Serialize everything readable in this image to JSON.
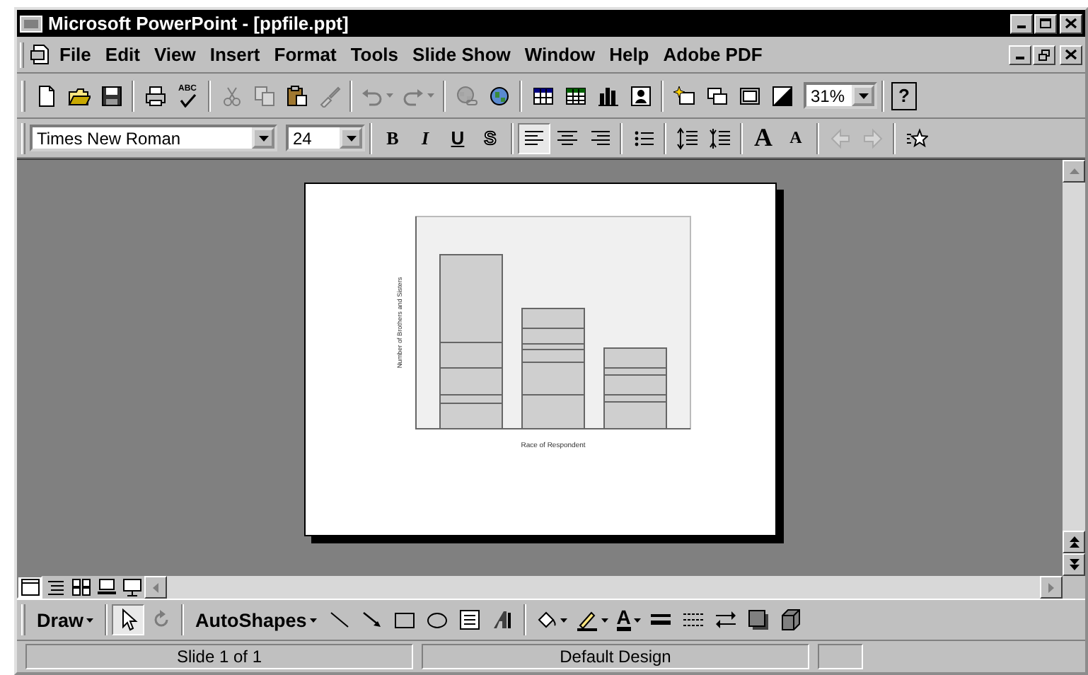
{
  "window": {
    "title": "Microsoft PowerPoint - [ppfile.ppt]"
  },
  "menu_bar": {
    "items": [
      "File",
      "Edit",
      "View",
      "Insert",
      "Format",
      "Tools",
      "Slide Show",
      "Window",
      "Help",
      "Adobe PDF"
    ]
  },
  "standard_toolbar": {
    "buttons": [
      {
        "disabled": false
      },
      {
        "disabled": false
      },
      {
        "disabled": false
      },
      {
        "disabled": false
      },
      {
        "disabled": false
      },
      {
        "disabled": true
      },
      {
        "disabled": true
      },
      {
        "disabled": false
      },
      {
        "disabled": true
      },
      {
        "disabled": true
      },
      {
        "disabled": true
      },
      {
        "disabled": true
      },
      {
        "disabled": false
      },
      {
        "disabled": false
      },
      {
        "disabled": false
      },
      {
        "disabled": false
      },
      {
        "disabled": false
      },
      {
        "disabled": false
      },
      {
        "disabled": false
      },
      {
        "disabled": false
      },
      {
        "disabled": false
      }
    ],
    "spelling_label": "ABC",
    "zoom": "31%",
    "help_label": "?"
  },
  "formatting_toolbar": {
    "font": "Times New Roman",
    "size": "24",
    "styles": [
      {
        "label": "B"
      },
      {
        "label": "I"
      },
      {
        "label": "U"
      },
      {
        "label": "S"
      }
    ],
    "align": [
      {
        "selected": true
      },
      {
        "selected": false
      },
      {
        "selected": false
      }
    ],
    "buttons": [
      {
        "disabled": false
      },
      {
        "disabled": false
      },
      {
        "disabled": false
      }
    ],
    "font_size_buttons": [
      {
        "label": "A",
        "disabled": false
      },
      {
        "label": "A",
        "disabled": false
      }
    ],
    "outline_buttons": [
      {
        "disabled": true
      },
      {
        "disabled": true
      },
      {
        "disabled": false
      }
    ]
  },
  "slide": {
    "chart": {
      "y_title": "Number of Brothers and Sisters",
      "x_title": "Race of Respondent"
    }
  },
  "view_buttons": [
    {
      "selected": true
    },
    {
      "selected": false
    },
    {
      "selected": false
    },
    {
      "selected": false
    },
    {
      "selected": false
    }
  ],
  "drawing_toolbar": {
    "menus": [
      "Draw",
      "AutoShapes"
    ],
    "tools": [
      {
        "selected": true,
        "disabled": false
      },
      {
        "selected": false,
        "disabled": true
      }
    ],
    "shapes": [
      {
        "disabled": false
      },
      {
        "disabled": false
      },
      {
        "disabled": false
      },
      {
        "disabled": false
      },
      {
        "disabled": false
      },
      {
        "disabled": false
      }
    ],
    "fill": {
      "disabled": false
    },
    "line_color": {
      "disabled": false
    },
    "font_color": {
      "label": "A",
      "disabled": false
    },
    "styles": [
      {
        "disabled": false
      },
      {
        "disabled": false
      },
      {
        "disabled": false
      },
      {
        "disabled": false
      },
      {
        "disabled": false
      }
    ]
  },
  "status_bar": {
    "panes": [
      "Slide 1 of 1",
      "Default Design"
    ]
  }
}
